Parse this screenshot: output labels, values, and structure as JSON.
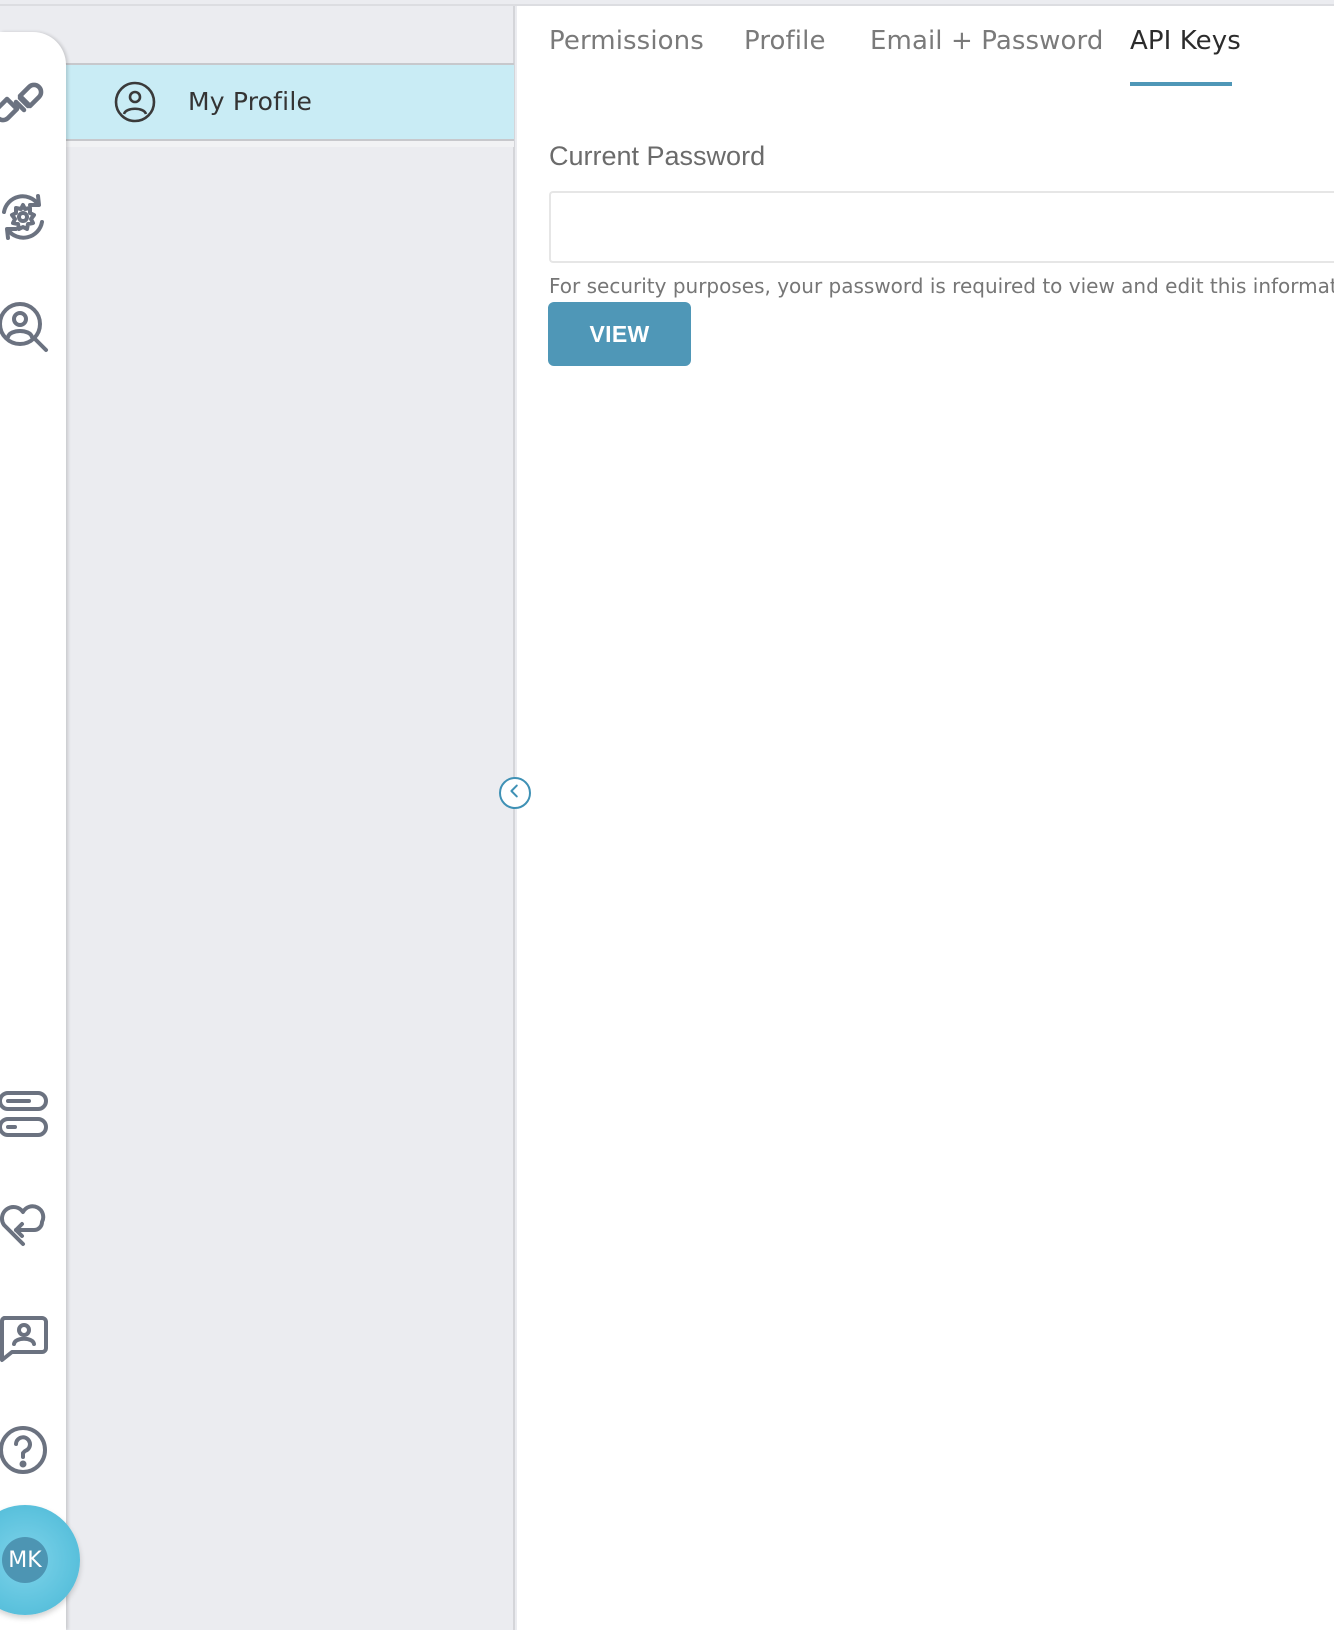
{
  "sidebar": {
    "rail_icons": [
      {
        "name": "link-icon"
      },
      {
        "name": "gear-sync-icon"
      },
      {
        "name": "user-search-icon"
      },
      {
        "name": "toggles-icon"
      },
      {
        "name": "heart-return-icon"
      },
      {
        "name": "contact-chat-icon"
      },
      {
        "name": "help-icon"
      }
    ],
    "avatar_initials": "MK"
  },
  "subnav": {
    "items": [
      {
        "label": "My Profile",
        "icon": "user-circle-icon",
        "active": true
      }
    ]
  },
  "main": {
    "tabs": [
      {
        "label": "Permissions",
        "active": false
      },
      {
        "label": "Profile",
        "active": false
      },
      {
        "label": "Email + Password",
        "active": false
      },
      {
        "label": "API Keys",
        "active": true
      }
    ],
    "form": {
      "current_password_label": "Current Password",
      "current_password_value": "",
      "helper_text": "For security purposes, your password is required to view and edit this information.",
      "view_button_label": "VIEW"
    }
  },
  "colors": {
    "accent": "#4f97b7",
    "active_nav_bg": "#c9ecf5",
    "avatar_outer": "#5ec3de",
    "avatar_inner": "#4d95b3",
    "icon_gray": "#6b7280"
  }
}
